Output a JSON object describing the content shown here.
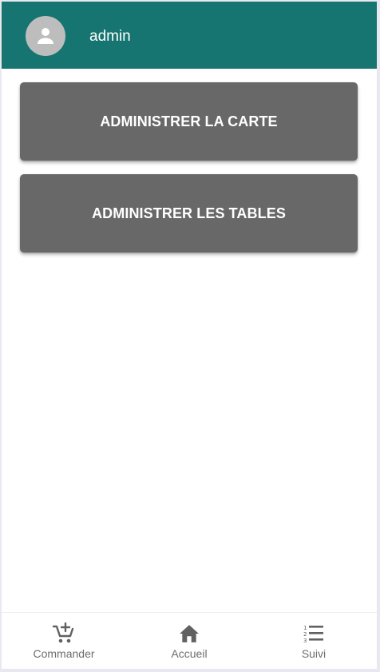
{
  "header": {
    "avatar_icon": "person-icon",
    "username": "admin",
    "background_color": "#167570"
  },
  "actions": [
    {
      "label": "ADMINISTRER LA CARTE"
    },
    {
      "label": "ADMINISTRER LES TABLES"
    }
  ],
  "bottom_nav": {
    "items": [
      {
        "label": "Commander",
        "icon": "cart-add-icon"
      },
      {
        "label": "Accueil",
        "icon": "home-icon"
      },
      {
        "label": "Suivi",
        "icon": "numbered-list-icon"
      }
    ]
  }
}
